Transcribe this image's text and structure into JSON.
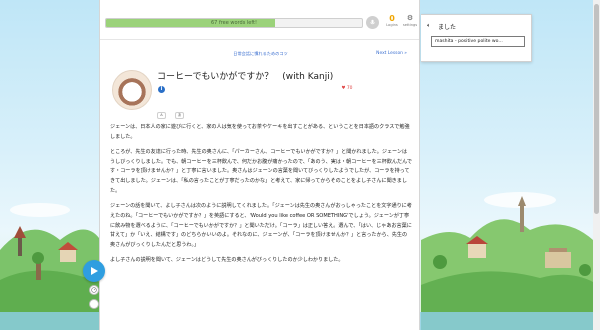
{
  "progress": {
    "label": "67 free words left!",
    "percent": 66
  },
  "header": {
    "logins_count": "0",
    "logins_label": "Logins",
    "settings_label": "settings"
  },
  "nav": {
    "center_link": "日常会話に慣れるためのコツ",
    "next_link": "Next Lesson »"
  },
  "lesson": {
    "title": "コーヒーでもいかがですか？　(with Kanji)",
    "info_icon": "i",
    "likes": "70",
    "tags": [
      "A",
      "あ"
    ]
  },
  "article": {
    "paragraphs": [
      "ジェーンは、日本人の家に遊びに行くと、家の人は気を使ってお茶やケーキを出すことがある、ということを日本語のクラスで勉強しました。",
      "ところが、先生の友達に行った時、先生の奥さんに、「パーカーさん、コーヒーでもいかがですか？」と聞かれました。ジェーンはうしびっくりしました。でも、朝コーヒーを三杯飲んで、何だかお腹が痛かったので、「あのう、実は・朝コーヒーを三杯飲んだんです・コーラを頂けませんか？」と丁寧に言いました。奥さんはジェーンの言葉を聞いてびっくりしたようでしたが、コーラを持ってきて出しました。ジェーンは、「私の言ったことが丁寧だったのかな」と考えて、家に帰ってからそのことをよし子さんに聞きました。",
      "ジェーンの話を聞いて、よし子さんは次のように説明してくれました。「ジェーンは先生の奥さんがおっしゃったことを文字通りに考えたのね。「コーヒーでもいかがですか？」を英語にすると、'Would you like coffee OR SOMETHING'でしょう。ジェーンが丁寧に飲み物を選べるように、「コーヒーでもいかがですか？」と聞いただけ。「コーラ」は正しい答え。選んで、「はい、じゃあお言葉に甘えて」か「いえ、結構です」のどちらかいいのよ。それなのに、ジェーンが、「コーラを頂けませんか？」と言ったから、先生の奥さんがびっくりしたんだと思うわ。」",
      "よし子さんの説明を聞いて、ジェーンはどうして先生の奥さんがびっくりしたのか少しわかりました。"
    ]
  },
  "dictionary": {
    "word": "ました",
    "definition": "mashita - positive polite wo..."
  },
  "icons": {
    "play": "play-icon",
    "mic": "microphone-icon",
    "settings": "gear-icon",
    "speaker": "speaker-icon",
    "info": "info-icon",
    "like": "heart-icon"
  }
}
